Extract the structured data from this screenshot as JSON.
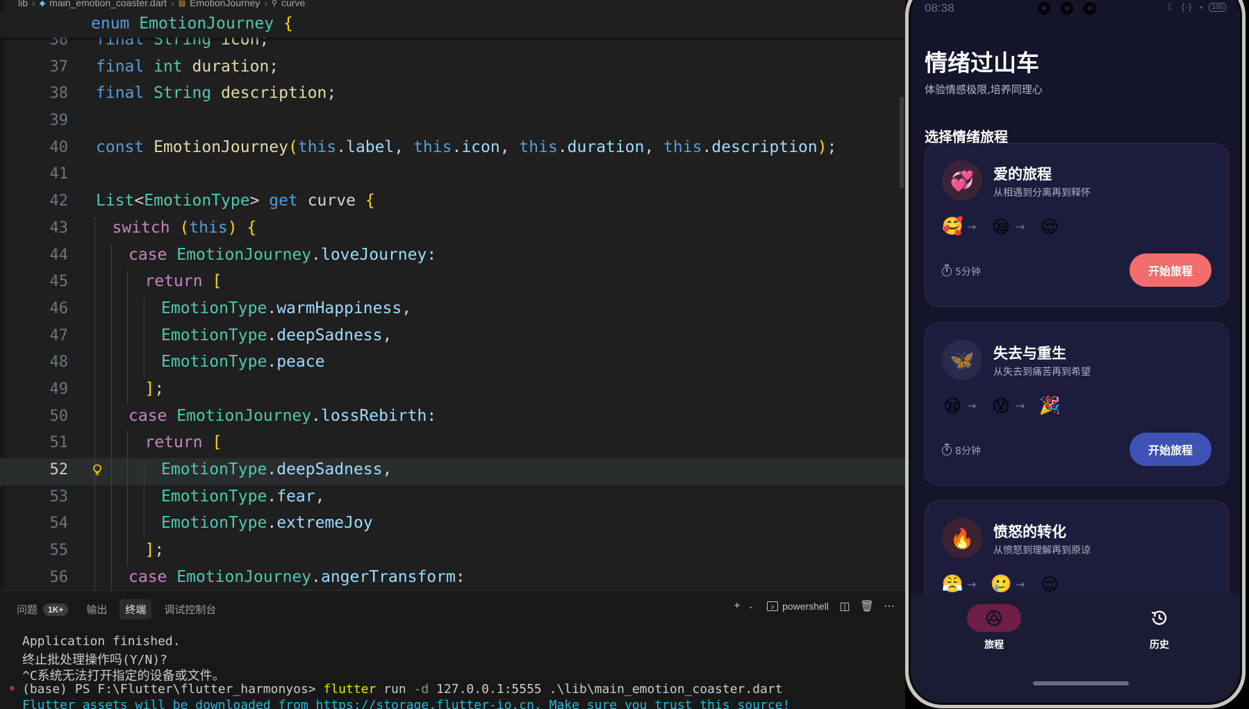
{
  "editor": {
    "breadcrumb": [
      "lib",
      "main_emotion_coaster.dart",
      "EmotionJourney",
      "curve"
    ],
    "sticky_line": "enum EmotionJourney {",
    "lines": [
      {
        "n": "36",
        "text": "final String icon;"
      },
      {
        "n": "37",
        "text": "final int duration;"
      },
      {
        "n": "38",
        "text": "final String description;"
      },
      {
        "n": "39",
        "text": ""
      },
      {
        "n": "40",
        "text": "const EmotionJourney(this.label, this.icon, this.duration, this.description);"
      },
      {
        "n": "41",
        "text": ""
      },
      {
        "n": "42",
        "text": "List<EmotionType> get curve {"
      },
      {
        "n": "43",
        "text": "switch (this) {"
      },
      {
        "n": "44",
        "text": "case EmotionJourney.loveJourney:"
      },
      {
        "n": "45",
        "text": "return ["
      },
      {
        "n": "46",
        "text": "EmotionType.warmHappiness,"
      },
      {
        "n": "47",
        "text": "EmotionType.deepSadness,"
      },
      {
        "n": "48",
        "text": "EmotionType.peace"
      },
      {
        "n": "49",
        "text": "];"
      },
      {
        "n": "50",
        "text": "case EmotionJourney.lossRebirth:"
      },
      {
        "n": "51",
        "text": "return ["
      },
      {
        "n": "52",
        "text": "EmotionType.deepSadness,"
      },
      {
        "n": "53",
        "text": "EmotionType.fear,"
      },
      {
        "n": "54",
        "text": "EmotionType.extremeJoy"
      },
      {
        "n": "55",
        "text": "];"
      },
      {
        "n": "56",
        "text": "case EmotionJourney.angerTransform:"
      }
    ],
    "active_line": "52"
  },
  "panel": {
    "tabs": [
      {
        "label": "问题",
        "badge": "1K+"
      },
      {
        "label": "输出"
      },
      {
        "label": "终端",
        "active": true
      },
      {
        "label": "调试控制台"
      }
    ],
    "shell_label": "powershell",
    "terminal": [
      "Application finished.",
      "终止批处理操作吗(Y/N)?",
      "^C系统无法打开指定的设备或文件。",
      "(base) PS F:\\Flutter\\flutter_harmonyos> flutter run -d 127.0.0.1:5555 .\\lib\\main_emotion_coaster.dart",
      "Flutter assets will be downloaded from https://storage.flutter-io.cn. Make sure you trust this source!"
    ]
  },
  "phone": {
    "status_time": "08:38",
    "battery": "100",
    "title": "情绪过山车",
    "subtitle": "体验情感极限,培养同理心",
    "section_title": "选择情绪旅程",
    "cards": [
      {
        "icon": "💞",
        "title": "爱的旅程",
        "subtitle": "从相遇到分离再到释怀",
        "curve": [
          "🥰",
          "😪",
          "😌"
        ],
        "duration": "5分钟",
        "button": "开始旅程",
        "button_color": "#f26d6d"
      },
      {
        "icon": "🦋",
        "title": "失去与重生",
        "subtitle": "从失去到痛苦再到希望",
        "curve": [
          "😪",
          "😰",
          "🎉"
        ],
        "duration": "8分钟",
        "button": "开始旅程",
        "button_color": "#3f51b5"
      },
      {
        "icon": "🔥",
        "title": "愤怒的转化",
        "subtitle": "从愤怒到理解再到原谅",
        "curve": [
          "😤",
          "🥲",
          "😌"
        ]
      }
    ],
    "nav": [
      {
        "label": "旅程",
        "icon": "journey-icon",
        "active": true
      },
      {
        "label": "历史",
        "icon": "history-icon"
      }
    ]
  }
}
